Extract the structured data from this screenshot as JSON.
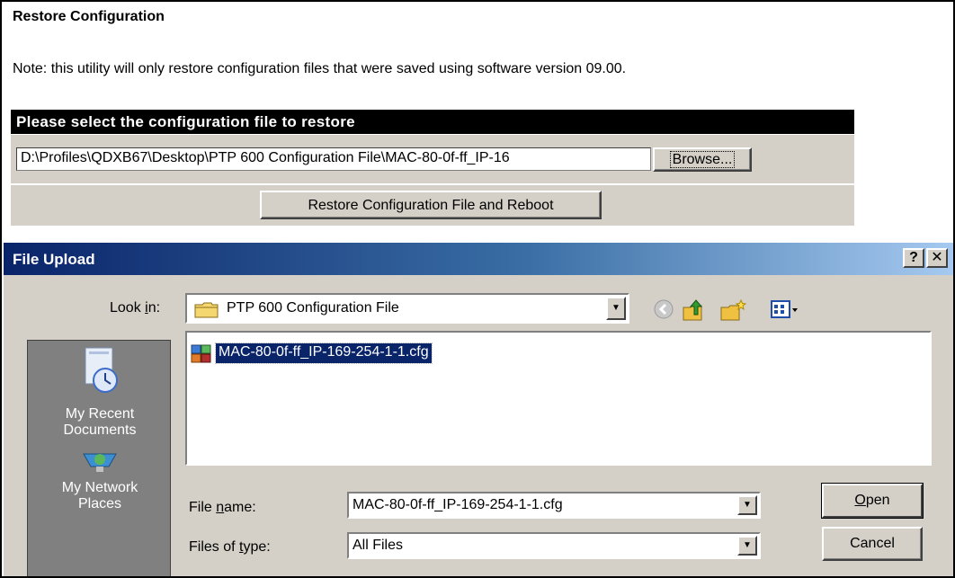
{
  "page": {
    "title": "Restore Configuration",
    "note": "Note: this utility will only restore configuration files that were saved using software version  09.00.",
    "section_header": "Please select the configuration file to restore",
    "file_path": "D:\\Profiles\\QDXB67\\Desktop\\PTP 600 Configuration File\\MAC-80-0f-ff_IP-16",
    "browse_label": "Browse...",
    "restore_button_label": "Restore Configuration File and Reboot"
  },
  "dialog": {
    "title": "File Upload",
    "help_label": "?",
    "close_label": "✕",
    "look_in": {
      "label_pre": "Look ",
      "label_key": "i",
      "label_post": "n:",
      "value": "PTP 600 Configuration File"
    },
    "toolbar_icons": [
      "back-icon",
      "up-folder-icon",
      "new-folder-icon",
      "view-menu-icon"
    ],
    "places": [
      {
        "label_line1": "My Recent",
        "label_line2": "Documents",
        "icon": "recent-documents-icon"
      },
      {
        "label_line1": "My Network",
        "label_line2": "Places",
        "icon": "network-places-icon"
      }
    ],
    "files": [
      {
        "name": "MAC-80-0f-ff_IP-169-254-1-1.cfg",
        "icon": "cfg-file-icon",
        "selected": true
      }
    ],
    "file_name": {
      "label_pre": "File ",
      "label_key": "n",
      "label_post": "ame:",
      "value": "MAC-80-0f-ff_IP-169-254-1-1.cfg"
    },
    "file_type": {
      "label_pre": "Files of ",
      "label_key": "t",
      "label_post": "ype:",
      "value": "All Files"
    },
    "open": {
      "key": "O",
      "rest": "pen"
    },
    "cancel_label": "Cancel"
  },
  "colors": {
    "titlebar_start": "#0a246a",
    "titlebar_end": "#a6caf0",
    "dialog_face": "#d4d0c8",
    "selection": "#0a246a",
    "places_bar": "#808080"
  }
}
